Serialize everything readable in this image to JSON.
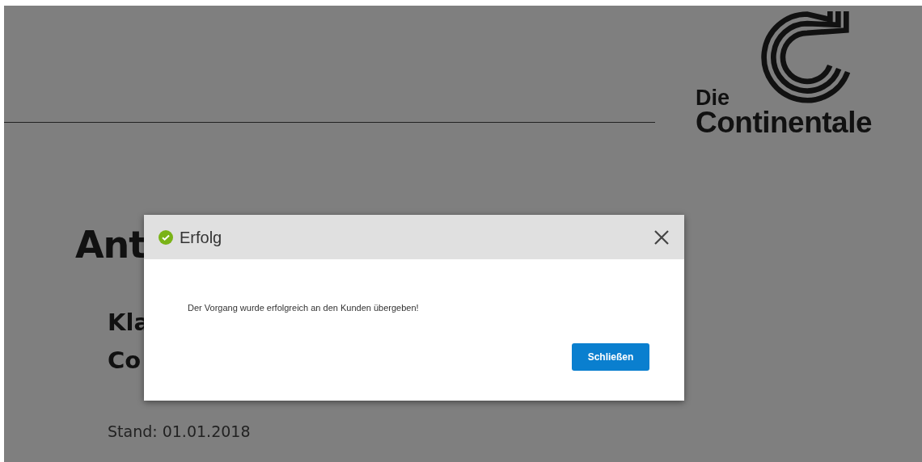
{
  "page": {
    "logo": {
      "line1": "Die",
      "line2": "Continentale"
    },
    "heading": "Ant",
    "subheading_lines": [
      "Kla",
      "Co"
    ],
    "date": "Stand: 01.01.2018"
  },
  "dialog": {
    "title": "Erfolg",
    "message": "Der Vorgang wurde erfolgreich an den Kunden übergeben!",
    "buttons": [
      {
        "label": "Schließen"
      }
    ]
  }
}
